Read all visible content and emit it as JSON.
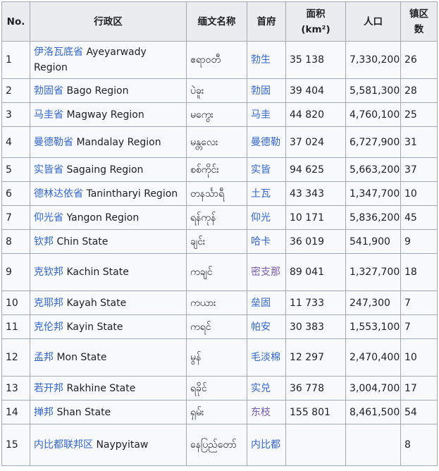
{
  "headers": [
    "No.",
    "行政区",
    "缅文名称",
    "首府",
    "面积",
    "(km²)",
    "人口",
    "镇区",
    "数"
  ],
  "rows": [
    {
      "no": "1",
      "cn": "伊洛瓦底省",
      "en": "Ayeyarwady Region",
      "my": "ဧရာဝတီ",
      "capital": "勃生",
      "area": "35 138",
      "pop": "7,330,200",
      "towns": "26"
    },
    {
      "no": "2",
      "cn": "勃固省",
      "en": "Bago Region",
      "my": "ပဲခူး",
      "capital": "勃固",
      "area": "39 404",
      "pop": "5,581,300",
      "towns": "28"
    },
    {
      "no": "3",
      "cn": "马圭省",
      "en": "Magway Region",
      "my": "မကွေး",
      "capital": "马圭",
      "area": "44 820",
      "pop": "4,760,100",
      "towns": "25"
    },
    {
      "no": "4",
      "cn": "曼德勒省",
      "en": "Mandalay Region",
      "my": "မန္တလေး",
      "capital": "曼德勒",
      "area": "37 024",
      "pop": "6,727,900",
      "towns": "31"
    },
    {
      "no": "5",
      "cn": "实皆省",
      "en": "Sagaing Region",
      "my": "စစ်ကိုင်း",
      "capital": "实皆",
      "area": "94 625",
      "pop": "5,663,200",
      "towns": "37"
    },
    {
      "no": "6",
      "cn": "德林达依省",
      "en": "Tanintharyi Region",
      "my": "တနင်္သာရီ",
      "capital": "土瓦",
      "area": "43 343",
      "pop": "1,347,700",
      "towns": "10"
    },
    {
      "no": "7",
      "cn": "仰光省",
      "en": "Yangon Region",
      "my": "ရန်ကုန်",
      "capital": "仰光",
      "area": "10 171",
      "pop": "5,836,200",
      "towns": "45"
    },
    {
      "no": "8",
      "cn": "钦邦",
      "en": "Chin State",
      "my": "ချင်း",
      "capital": "哈卡",
      "area": "36 019",
      "pop": "541,900",
      "towns": "9"
    },
    {
      "no": "9",
      "cn": "克钦邦",
      "en": "Kachin State",
      "my": "ကချင်",
      "capital": "密支那",
      "area": "89 041",
      "pop": "1,327,700",
      "towns": "18"
    },
    {
      "no": "10",
      "cn": "克耶邦",
      "en": "Kayah State",
      "my": "ကယား",
      "capital": "垒固",
      "area": "11 733",
      "pop": "247,300",
      "towns": "7"
    },
    {
      "no": "11",
      "cn": "克伦邦",
      "en": "Kayin State",
      "my": "ကရင်",
      "capital": "帕安",
      "area": "30 383",
      "pop": "1,553,100",
      "towns": "7"
    },
    {
      "no": "12",
      "cn": "孟邦",
      "en": "Mon State",
      "my": "မွန်",
      "capital": "毛淡棉",
      "area": "12 297",
      "pop": "2,470,400",
      "towns": "10"
    },
    {
      "no": "13",
      "cn": "若开邦",
      "en": "Rakhine State",
      "my": "ရခိုင်",
      "capital": "实兑",
      "area": "36 778",
      "pop": "3,004,700",
      "towns": "17"
    },
    {
      "no": "14",
      "cn": "掸邦",
      "en": "Shan State",
      "my": "ရှမ်း",
      "capital": "东枝",
      "area": "155 801",
      "pop": "8,461,500",
      "towns": "54"
    },
    {
      "no": "15",
      "cn": "内比都联邦区",
      "en": "Naypyitaw",
      "my": "နေပြည်တော်",
      "capital": "内比都",
      "area": "",
      "pop": "",
      "towns": "8"
    }
  ]
}
